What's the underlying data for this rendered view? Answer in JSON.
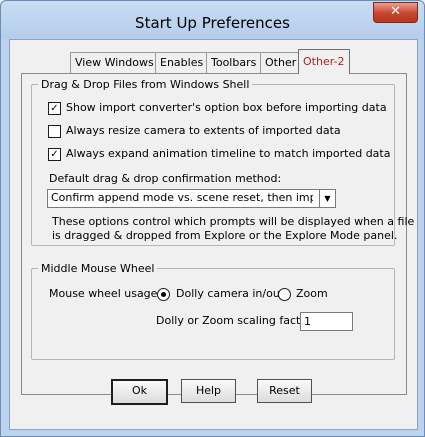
{
  "window": {
    "title": "Start Up Preferences",
    "close_label": "✕"
  },
  "tabs": [
    {
      "label": "View Windows"
    },
    {
      "label": "Enables"
    },
    {
      "label": "Toolbars"
    },
    {
      "label": "Other"
    },
    {
      "label": "Other-2",
      "active": true
    }
  ],
  "drag_drop": {
    "legend": "Drag & Drop Files from Windows Shell",
    "options": [
      {
        "label": "Show import converter's option box before importing data",
        "checked": true
      },
      {
        "label": "Always resize camera to extents of imported data",
        "checked": false
      },
      {
        "label": "Always expand animation timeline to match imported data",
        "checked": true
      }
    ],
    "default_method_label": "Default drag & drop confirmation method:",
    "default_method_value": "Confirm append mode vs. scene reset, then import new",
    "info_line1": "These options control which prompts will be displayed when a file",
    "info_line2": "is dragged & dropped from Explore or the Explore Mode panel."
  },
  "middle_mouse": {
    "legend": "Middle Mouse Wheel",
    "usage_label": "Mouse wheel usage:",
    "options": [
      {
        "label": "Dolly camera in/out",
        "selected": true
      },
      {
        "label": "Zoom",
        "selected": false
      }
    ],
    "scaling_label": "Dolly or Zoom scaling factor:",
    "scaling_value": "1"
  },
  "buttons": {
    "ok": "Ok",
    "help": "Help",
    "reset": "Reset"
  },
  "colors": {
    "active_tab_text": "#b2201a",
    "titlebar": "#bcd3ee",
    "close_button": "#c8442d"
  }
}
